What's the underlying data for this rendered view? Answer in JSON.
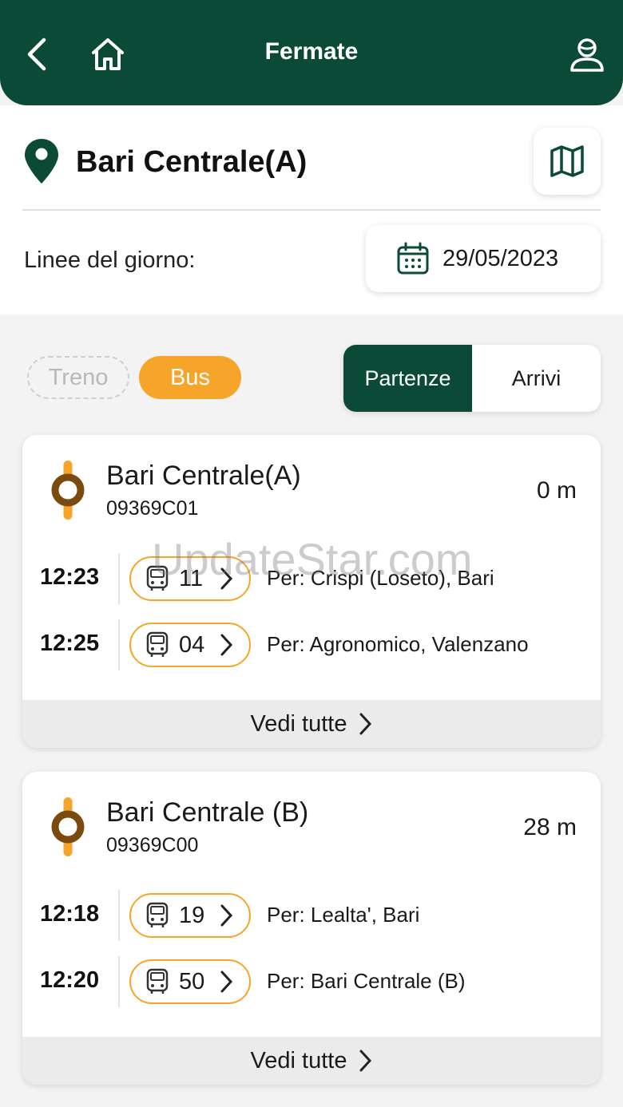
{
  "header": {
    "title": "Fermate"
  },
  "stop": {
    "name": "Bari Centrale(A)"
  },
  "day": {
    "label": "Linee del giorno:",
    "date": "29/05/2023"
  },
  "filters": {
    "treno": "Treno",
    "bus": "Bus"
  },
  "toggle": {
    "departures": "Partenze",
    "arrivals": "Arrivi"
  },
  "cards": [
    {
      "name": "Bari Centrale(A)",
      "code": "09369C01",
      "distance": "0 m",
      "rows": [
        {
          "time": "12:23",
          "line": "11",
          "dest": "Per: Crispi (Loseto), Bari"
        },
        {
          "time": "12:25",
          "line": "04",
          "dest": "Per: Agronomico, Valenzano"
        }
      ],
      "footer": "Vedi tutte"
    },
    {
      "name": "Bari Centrale (B)",
      "code": "09369C00",
      "distance": "28 m",
      "rows": [
        {
          "time": "12:18",
          "line": "19",
          "dest": "Per: Lealta', Bari"
        },
        {
          "time": "12:20",
          "line": "50",
          "dest": "Per: Bari Centrale (B)"
        }
      ],
      "footer": "Vedi tutte"
    }
  ],
  "watermark": "UpdateStar.com",
  "colors": {
    "primary": "#0b4a36",
    "accent": "#f7a52a",
    "stop_ring": "#7a4a0f"
  },
  "icons": [
    "back-icon",
    "home-icon",
    "profile-icon",
    "location-pin-icon",
    "map-icon",
    "calendar-icon",
    "stop-marker-icon",
    "bus-icon",
    "chevron-right-icon"
  ]
}
